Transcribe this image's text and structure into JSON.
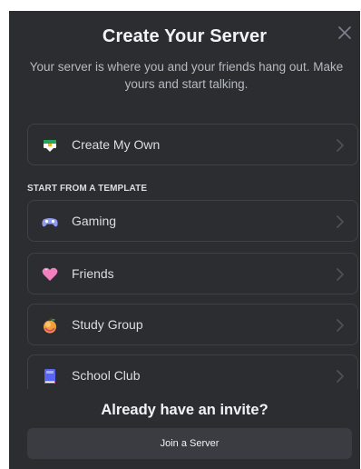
{
  "modal": {
    "title": "Create Your Server",
    "subtitle": "Your server is where you and your friends hang out. Make yours and start talking.",
    "close_icon": "close-icon"
  },
  "create_own": {
    "label": "Create My Own",
    "icon": "create-server-icon"
  },
  "templates": {
    "section_label": "START FROM A TEMPLATE",
    "items": [
      {
        "label": "Gaming",
        "icon": "gamepad-icon"
      },
      {
        "label": "Friends",
        "icon": "heart-icon"
      },
      {
        "label": "Study Group",
        "icon": "apple-icon"
      },
      {
        "label": "School Club",
        "icon": "book-icon"
      }
    ]
  },
  "footer": {
    "title": "Already have an invite?",
    "join_label": "Join a Server"
  },
  "colors": {
    "background": "#2b2d31",
    "border": "#3f4147",
    "text_primary": "#f2f3f5",
    "text_secondary": "#b5bac1",
    "button": "#3a3c42"
  }
}
